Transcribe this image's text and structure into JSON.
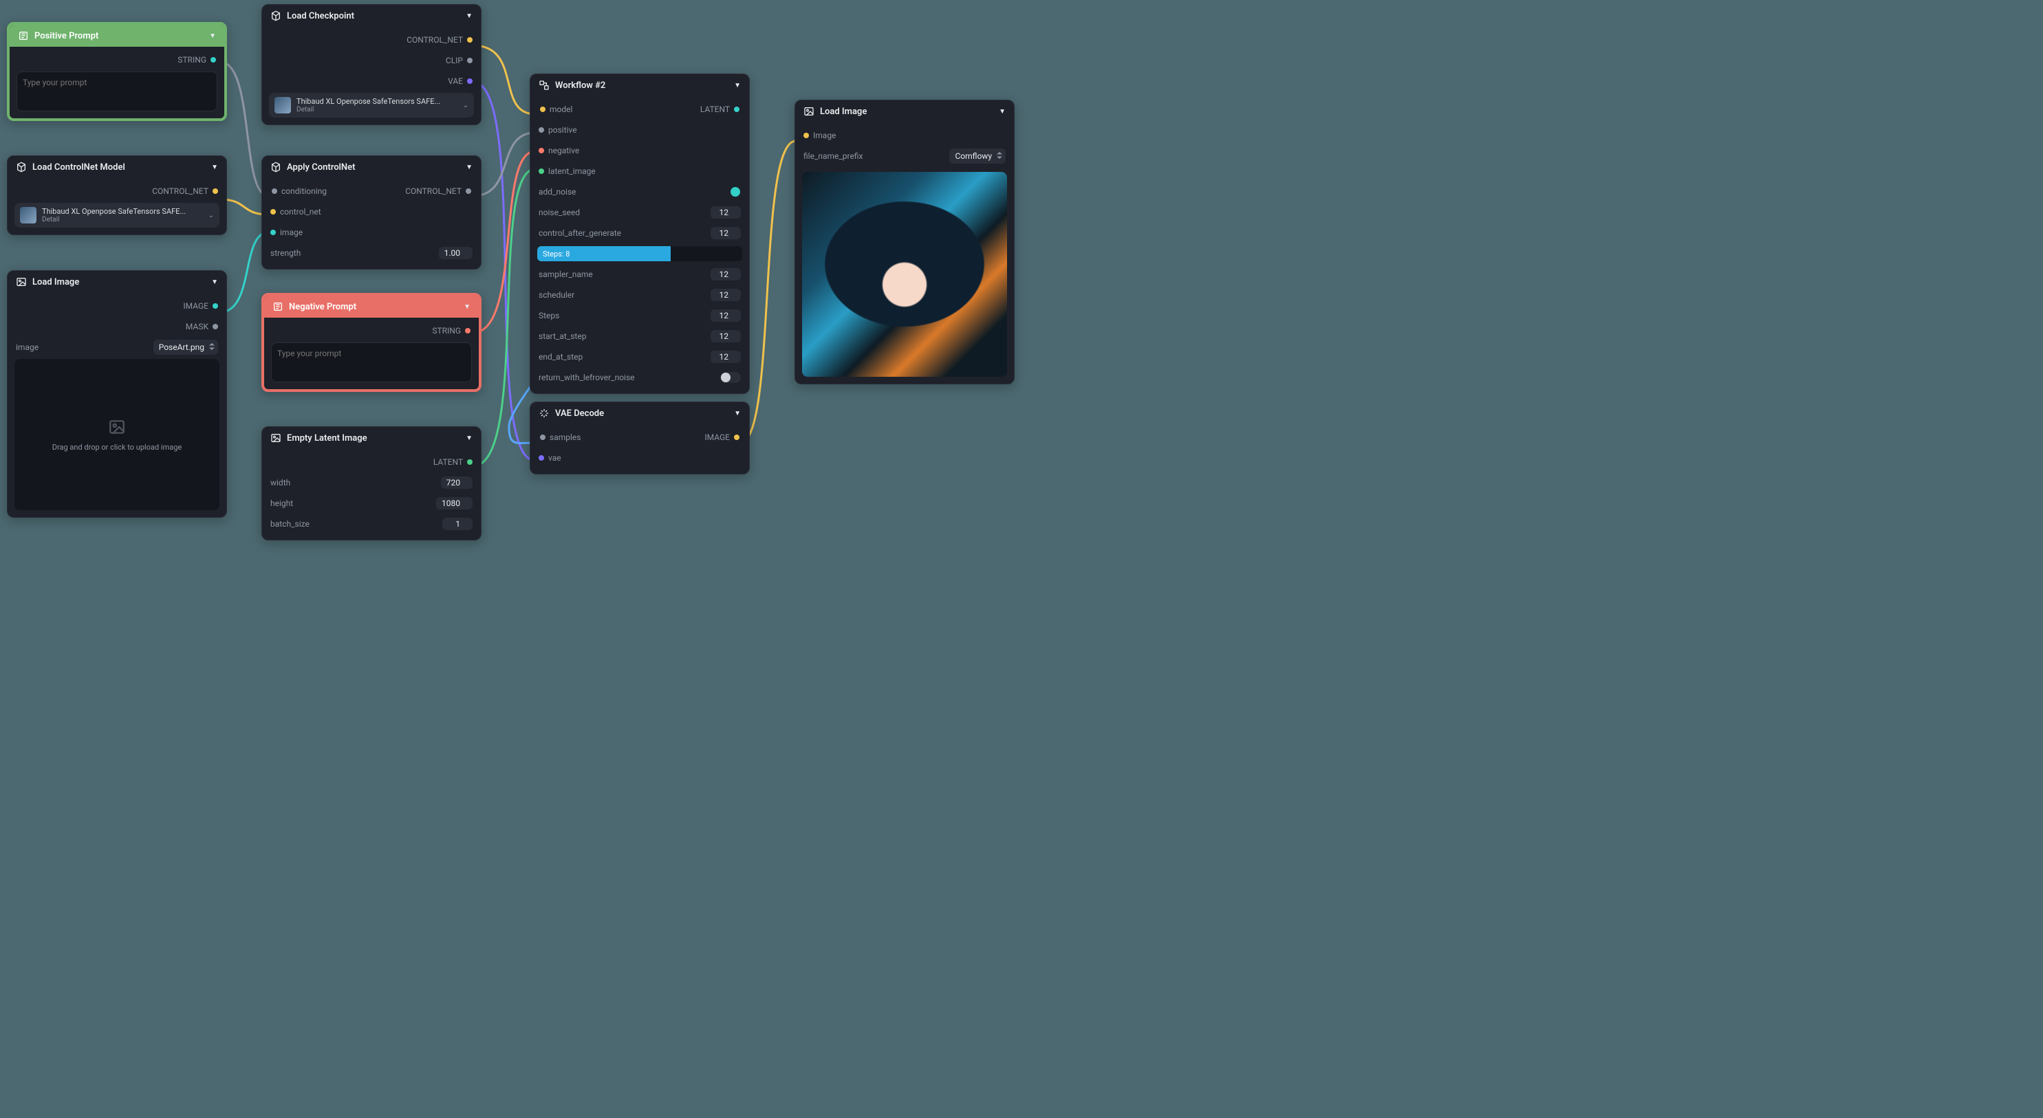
{
  "nodes": {
    "positivePrompt": {
      "title": "Positive Prompt",
      "outputs": {
        "string": "STRING"
      },
      "placeholder": "Type your prompt"
    },
    "loadControlNetModel": {
      "title": "Load ControlNet Model",
      "outputs": {
        "controlNet": "CONTROL_NET"
      },
      "model": {
        "name": "Thibaud XL Openpose SafeTensors SAFE...",
        "detail": "Detail"
      }
    },
    "loadImagePose": {
      "title": "Load Image",
      "outputs": {
        "image": "IMAGE",
        "mask": "MASK"
      },
      "fields": {
        "image_label": "image",
        "image_value": "PoseArt.png"
      },
      "dropzone": "Drag and drop or click to upload image"
    },
    "loadCheckpoint": {
      "title": "Load Checkpoint",
      "outputs": {
        "controlNet": "CONTROL_NET",
        "clip": "CLIP",
        "vae": "VAE"
      },
      "model": {
        "name": "Thibaud XL Openpose SafeTensors SAFE...",
        "detail": "Detail"
      }
    },
    "applyControlNet": {
      "title": "Apply ControlNet",
      "inputs": {
        "conditioning": "conditioning",
        "control_net": "control_net",
        "image": "image"
      },
      "outputs": {
        "controlNet": "CONTROL_NET"
      },
      "fields": {
        "strength_label": "strength",
        "strength_value": "1.00"
      }
    },
    "negativePrompt": {
      "title": "Negative Prompt",
      "outputs": {
        "string": "STRING"
      },
      "placeholder": "Type your prompt"
    },
    "emptyLatent": {
      "title": "Empty Latent Image",
      "outputs": {
        "latent": "LATENT"
      },
      "fields": {
        "width_label": "width",
        "width_value": "720",
        "height_label": "height",
        "height_value": "1080",
        "batch_label": "batch_size",
        "batch_value": "1"
      }
    },
    "workflow": {
      "title": "Workflow #2",
      "inputs": {
        "model": "model",
        "positive": "positive",
        "negative": "negative",
        "latent_image": "latent_image"
      },
      "outputs": {
        "latent": "LATENT"
      },
      "fields": {
        "add_noise": "add_noise",
        "noise_seed_label": "noise_seed",
        "noise_seed_value": "12",
        "cag_label": "control_after_generate",
        "cag_value": "12",
        "progress_caption": "Steps: 8",
        "progress_pct": 65,
        "sampler_label": "sampler_name",
        "sampler_value": "12",
        "scheduler_label": "scheduler",
        "scheduler_value": "12",
        "steps_label": "Steps",
        "steps_value": "12",
        "start_label": "start_at_step",
        "start_value": "12",
        "end_label": "end_at_step",
        "end_value": "12",
        "return_label": "return_with_lefrover_noise"
      }
    },
    "vaeDecode": {
      "title": "VAE Decode",
      "inputs": {
        "samples": "samples",
        "vae": "vae"
      },
      "outputs": {
        "image": "IMAGE"
      }
    },
    "loadImageOut": {
      "title": "Load Image",
      "inputs": {
        "image": "Image"
      },
      "fields": {
        "prefix_label": "file_name_prefix",
        "prefix_value": "Comflowy"
      }
    }
  },
  "colors": {
    "teal": "#34d1c9",
    "grey": "#8f96a3",
    "violet": "#7c6cff",
    "yellow": "#f0c24c",
    "green": "#4cd08a",
    "red": "#ff7a6b",
    "blue": "#5aa7ff",
    "lime": "#7ad14c"
  }
}
